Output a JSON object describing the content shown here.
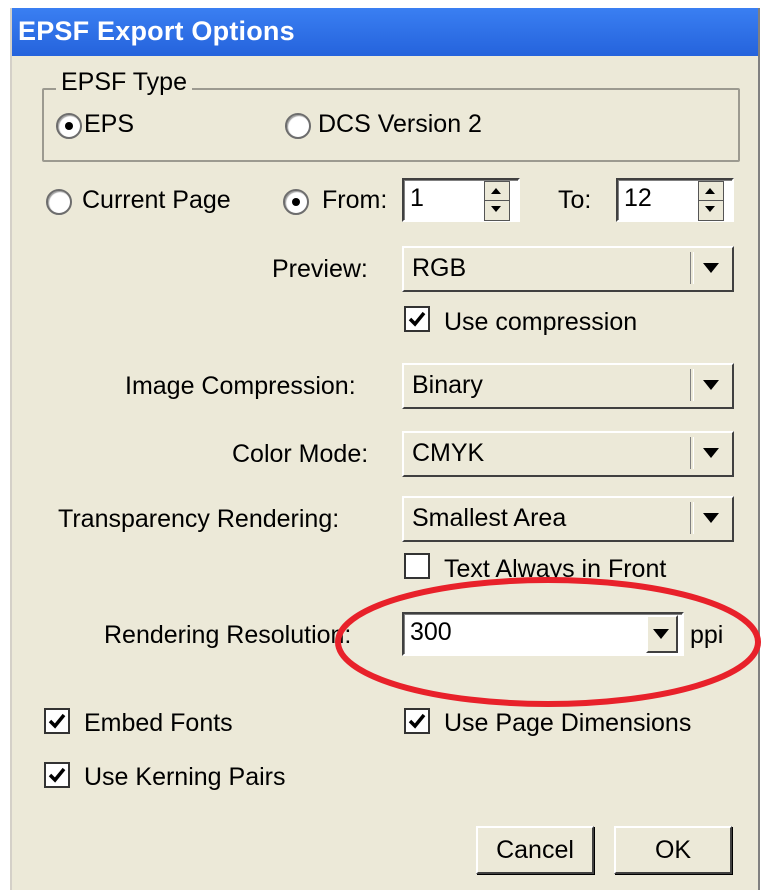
{
  "window": {
    "title": "EPSF Export Options"
  },
  "epsf_type": {
    "legend": "EPSF Type",
    "options": [
      "EPS",
      "DCS Version 2"
    ],
    "selected": "EPS"
  },
  "pages": {
    "current_page_label": "Current Page",
    "from_label": "From:",
    "from_value": "1",
    "to_label": "To:",
    "to_value": "12",
    "selected": "From"
  },
  "preview": {
    "label": "Preview:",
    "value": "RGB"
  },
  "use_compression": {
    "label": "Use compression",
    "checked": true
  },
  "image_compression": {
    "label": "Image Compression:",
    "value": "Binary"
  },
  "color_mode": {
    "label": "Color Mode:",
    "value": "CMYK"
  },
  "transparency": {
    "label": "Transparency Rendering:",
    "value": "Smallest Area"
  },
  "text_always_front": {
    "label": "Text Always in Front",
    "checked": false
  },
  "resolution": {
    "label": "Rendering Resolution:",
    "value": "300",
    "unit": "ppi"
  },
  "embed_fonts": {
    "label": "Embed Fonts",
    "checked": true
  },
  "use_page_dimensions": {
    "label": "Use Page Dimensions",
    "checked": true
  },
  "use_kerning_pairs": {
    "label": "Use Kerning Pairs",
    "checked": true
  },
  "buttons": {
    "cancel": "Cancel",
    "ok": "OK"
  },
  "annotation": {
    "color": "#e8212a"
  }
}
